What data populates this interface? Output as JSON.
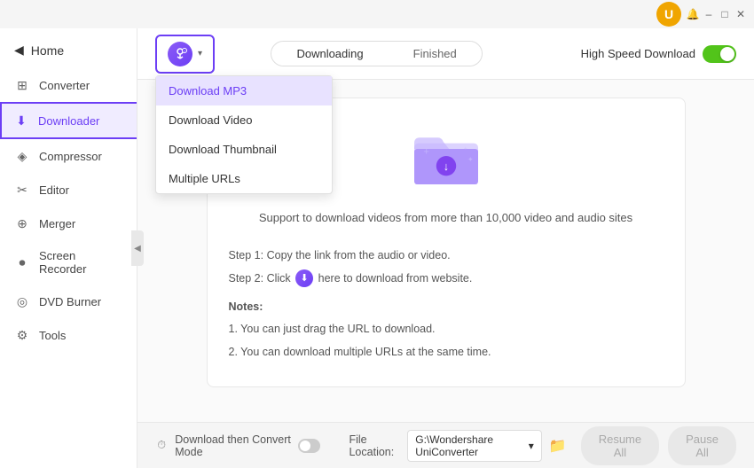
{
  "titleBar": {
    "userIconColor": "#f0a500",
    "userIconText": "U",
    "minLabel": "–",
    "maxLabel": "□",
    "closeLabel": "✕"
  },
  "sidebar": {
    "homeLabel": "Home",
    "items": [
      {
        "id": "converter",
        "label": "Converter",
        "icon": "⊞"
      },
      {
        "id": "downloader",
        "label": "Downloader",
        "icon": "⬇"
      },
      {
        "id": "compressor",
        "label": "Compressor",
        "icon": "◈"
      },
      {
        "id": "editor",
        "label": "Editor",
        "icon": "✂"
      },
      {
        "id": "merger",
        "label": "Merger",
        "icon": "⊕"
      },
      {
        "id": "screen-recorder",
        "label": "Screen Recorder",
        "icon": "⏺"
      },
      {
        "id": "dvd-burner",
        "label": "DVD Burner",
        "icon": "◎"
      },
      {
        "id": "tools",
        "label": "Tools",
        "icon": "⚙"
      }
    ]
  },
  "topBar": {
    "downloadBtnAlt": "Download",
    "dropdownItems": [
      {
        "id": "mp3",
        "label": "Download MP3",
        "selected": true
      },
      {
        "id": "video",
        "label": "Download Video",
        "selected": false
      },
      {
        "id": "thumbnail",
        "label": "Download Thumbnail",
        "selected": false
      },
      {
        "id": "multiple",
        "label": "Multiple URLs",
        "selected": false
      }
    ],
    "tabs": [
      {
        "id": "downloading",
        "label": "Downloading",
        "active": true
      },
      {
        "id": "finished",
        "label": "Finished",
        "active": false
      }
    ],
    "speedLabel": "High Speed Download"
  },
  "contentPanel": {
    "supportText": "Support to download videos from more than 10,000 video and audio sites",
    "step1": "Step 1: Copy the link from the audio or video.",
    "step2pre": "Step 2: Click",
    "step2post": "here to download from website.",
    "notesTitle": "Notes:",
    "note1": "1. You can just drag the URL to download.",
    "note2": "2. You can download multiple URLs at the same time."
  },
  "bottomBar": {
    "convertModeLabel": "Download then Convert Mode",
    "fileLocationLabel": "File Location:",
    "filePath": "G:\\Wondershare UniConverter",
    "resumeLabel": "Resume All",
    "pauseLabel": "Pause All"
  }
}
